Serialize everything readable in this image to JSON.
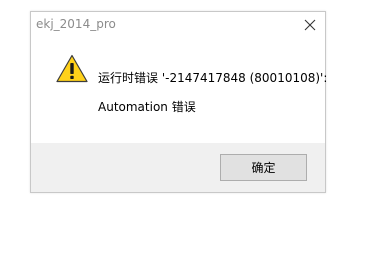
{
  "dialog": {
    "title": "ekj_2014_pro",
    "message_line1": "运行时错误 '-2147417848 (80010108)':",
    "message_line2": "Automation 错误",
    "ok_label": "确定",
    "icon": "warning-icon",
    "close_icon": "close-icon"
  },
  "colors": {
    "footer_bg": "#f0f0f0",
    "button_bg": "#e1e1e1",
    "button_border": "#adadad",
    "warning_yellow": "#ffd11a",
    "title_text": "#8c8c8c"
  }
}
